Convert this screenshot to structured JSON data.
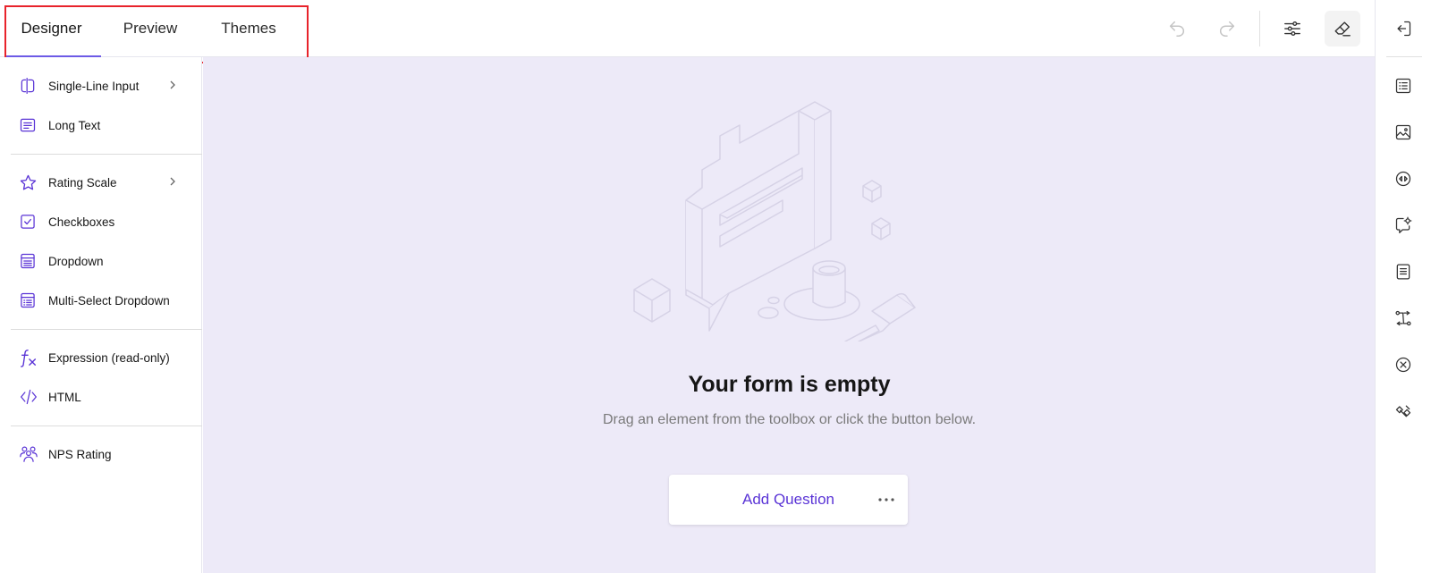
{
  "tabs": [
    {
      "label": "Designer",
      "active": true
    },
    {
      "label": "Preview",
      "active": false
    },
    {
      "label": "Themes",
      "active": false
    }
  ],
  "toolbar": {
    "undo_icon": "undo-icon",
    "redo_icon": "redo-icon",
    "settings_icon": "sliders-icon",
    "eraser_icon": "eraser-icon"
  },
  "toolbox": {
    "items": [
      {
        "label": "Single-Line Input",
        "icon": "text-cursor-icon",
        "has_submenu": true
      },
      {
        "label": "Long Text",
        "icon": "comment-icon",
        "has_submenu": false
      },
      {
        "label": "Rating Scale",
        "icon": "star-icon",
        "has_submenu": true
      },
      {
        "label": "Checkboxes",
        "icon": "checkbox-icon",
        "has_submenu": false
      },
      {
        "label": "Dropdown",
        "icon": "dropdown-icon",
        "has_submenu": false
      },
      {
        "label": "Multi-Select Dropdown",
        "icon": "multi-select-icon",
        "has_submenu": false
      },
      {
        "label": "Expression (read-only)",
        "icon": "fx-icon",
        "has_submenu": false
      },
      {
        "label": "HTML",
        "icon": "code-icon",
        "has_submenu": false
      },
      {
        "label": "NPS Rating",
        "icon": "users-icon",
        "has_submenu": false
      }
    ]
  },
  "canvas": {
    "title": "Your form is empty",
    "subtitle": "Drag an element from the toolbox or click the button below.",
    "add_question_label": "Add Question",
    "more_icon": "more-horizontal-icon"
  },
  "rail": {
    "icons": [
      "collapse-icon",
      "list-icon",
      "image-icon",
      "media-icon",
      "chat-settings-icon",
      "document-icon",
      "logic-icon",
      "close-circle-icon",
      "translate-icon"
    ]
  },
  "colors": {
    "accent": "#5a34d6",
    "canvas_bg": "#edeaf8",
    "highlight": "#e8232b"
  }
}
